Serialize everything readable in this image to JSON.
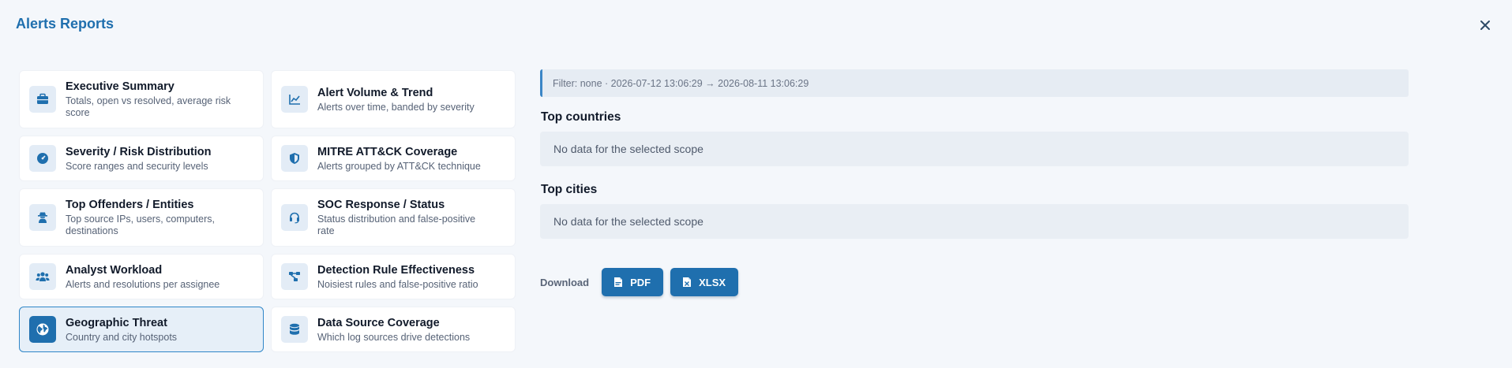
{
  "modal": {
    "title": "Alerts Reports"
  },
  "reports": [
    {
      "title": "Executive Summary",
      "desc": "Totals, open vs resolved, average risk score"
    },
    {
      "title": "Alert Volume & Trend",
      "desc": "Alerts over time, banded by severity"
    },
    {
      "title": "Severity / Risk Distribution",
      "desc": "Score ranges and security levels"
    },
    {
      "title": "MITRE ATT&CK Coverage",
      "desc": "Alerts grouped by ATT&CK technique"
    },
    {
      "title": "Top Offenders / Entities",
      "desc": "Top source IPs, users, computers, destinations"
    },
    {
      "title": "SOC Response / Status",
      "desc": "Status distribution and false-positive rate"
    },
    {
      "title": "Analyst Workload",
      "desc": "Alerts and resolutions per assignee"
    },
    {
      "title": "Detection Rule Effectiveness",
      "desc": "Noisiest rules and false-positive ratio"
    },
    {
      "title": "Geographic Threat",
      "desc": "Country and city hotspots"
    },
    {
      "title": "Data Source Coverage",
      "desc": "Which log sources drive detections"
    }
  ],
  "filter": {
    "text": "Filter: none · 2026-07-12 13:06:29 → 2026-08-11 13:06:29"
  },
  "sections": {
    "countries": {
      "title": "Top countries",
      "empty": "No data for the selected scope"
    },
    "cities": {
      "title": "Top cities",
      "empty": "No data for the selected scope"
    }
  },
  "download": {
    "label": "Download",
    "pdf": "PDF",
    "xlsx": "XLSX"
  },
  "colors": {
    "accent": "#1f6fae",
    "active_border": "#2f86c8"
  }
}
